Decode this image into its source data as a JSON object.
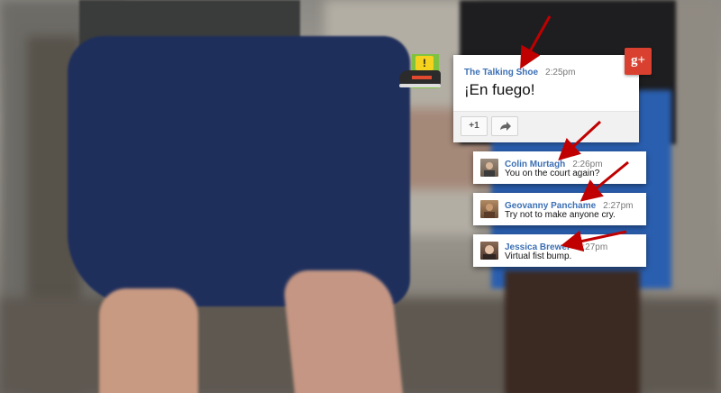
{
  "post": {
    "author": "The Talking Shoe",
    "time": "2:25pm",
    "text": "¡En fuego!",
    "plus_one_label": "+1",
    "share_icon": "share-arrow-icon",
    "social_badge": "g+"
  },
  "comments": [
    {
      "name": "Colin Murtagh",
      "time": "2:26pm",
      "text": "You on the court again?"
    },
    {
      "name": "Geovanny Panchame",
      "time": "2:27pm",
      "text": "Try not to make anyone cry."
    },
    {
      "name": "Jessica Brewer",
      "time": "2:27pm",
      "text": "Virtual fist bump."
    }
  ],
  "colors": {
    "name_blue": "#3b6fb4",
    "gplus_red": "#d9402f",
    "arrow_red": "#c00000",
    "shoe_icon_green": "#7fc241"
  }
}
